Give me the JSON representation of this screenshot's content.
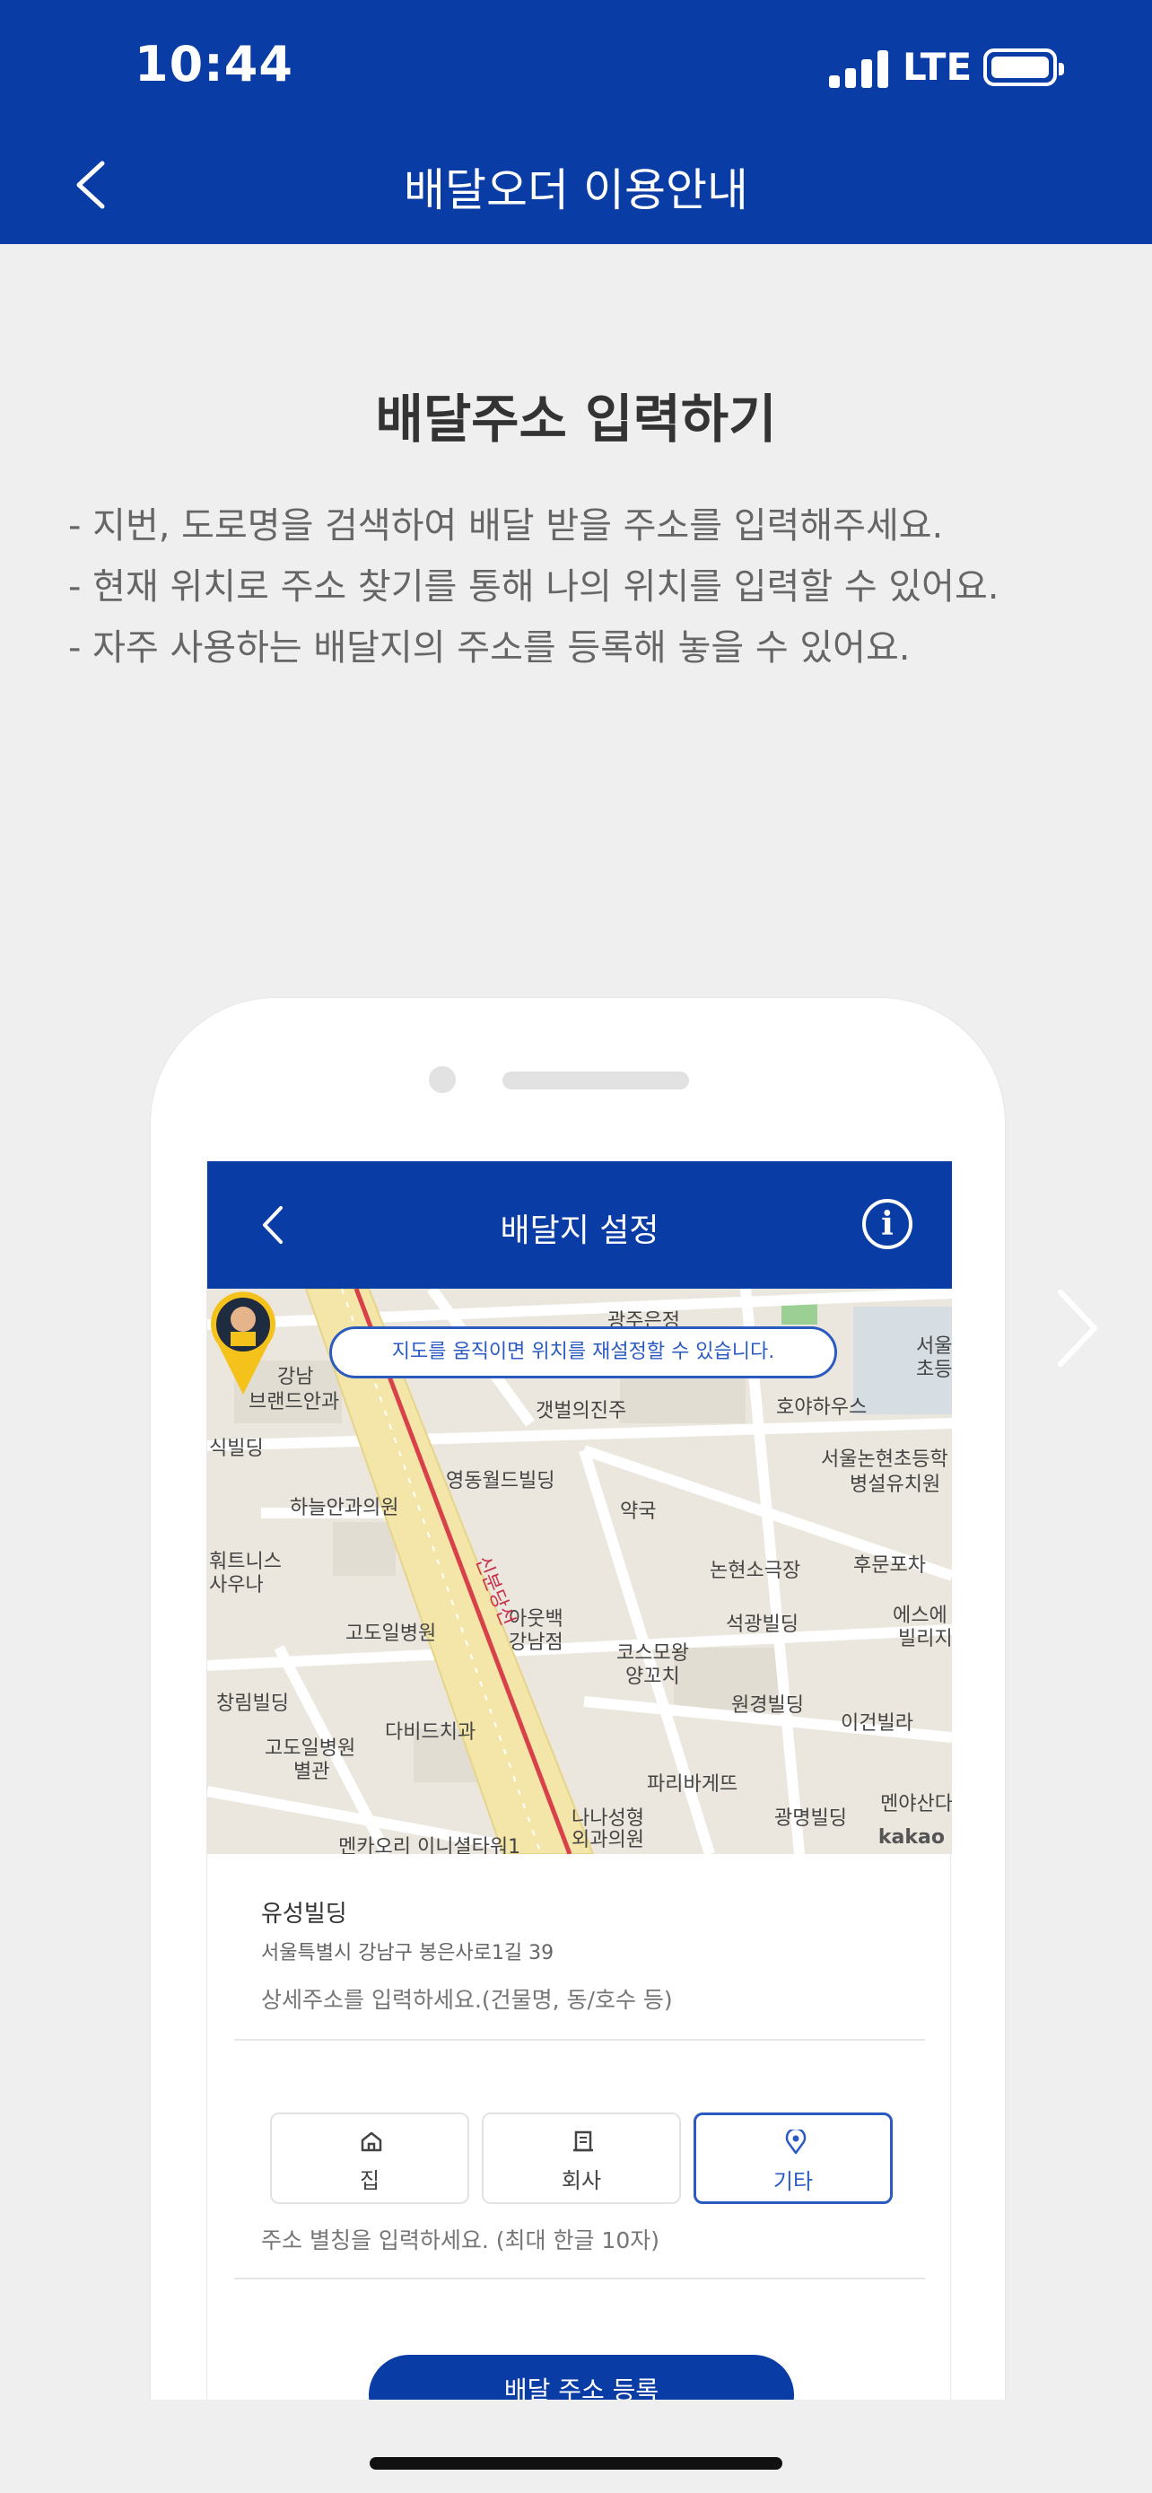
{
  "status_bar": {
    "time": "10:44",
    "network": "LTE"
  },
  "nav": {
    "title": "배달오더 이용안내",
    "back_icon": "chevron-left-icon"
  },
  "content": {
    "heading": "배달주소 입력하기",
    "bullets": [
      "- 지번, 도로명을 검색하여 배달 받을 주소를 입력해주세요.",
      "- 현재 위치로 주소 찾기를 통해 나의 위치를 입력할 수 있어요.",
      "- 자주 사용하는 배달지의 주소를 등록해 놓을 수 있어요."
    ]
  },
  "mockup": {
    "screen_title": "배달지 설정",
    "info_icon": "i",
    "map_banner": "지도를 움직이면 위치를 재설정할 수 있습니다.",
    "map_attribution": "kakao",
    "map_labels": [
      "광주은정",
      "강남",
      "브랜드안과",
      "갯벌의진주",
      "호야하우스",
      "서울",
      "초등",
      "식빌딩",
      "영동월드빌딩",
      "서울논현초등학",
      "병설유치원",
      "하늘안과의원",
      "훠트니스",
      "사우나",
      "약국",
      "논현소극장",
      "후문포차",
      "아웃백",
      "강남점",
      "고도일병원",
      "석광빌딩",
      "에스에",
      "빌리지",
      "코스모왕",
      "양꼬치",
      "창림빌딩",
      "원경빌딩",
      "이건빌라",
      "고도일병원",
      "별관",
      "다비드치과",
      "파리바게뜨",
      "광명빌딩",
      "멘야산다",
      "나나성형",
      "외과의원",
      "멘카오리 이니셜타워1",
      "신분당선"
    ],
    "place_name": "유성빌딩",
    "place_address": "서울특별시 강남구 봉은사로1길 39",
    "detail_placeholder": "상세주소를 입력하세요.(건물명, 동/호수 등)",
    "address_types": [
      {
        "label": "집",
        "icon": "home-icon",
        "selected": false
      },
      {
        "label": "회사",
        "icon": "building-icon",
        "selected": false
      },
      {
        "label": "기타",
        "icon": "location-pin-icon",
        "selected": true
      }
    ],
    "alias_placeholder": "주소 별칭을 입력하세요. (최대 한글 10자)",
    "register_label": "배달 주소 등록"
  },
  "colors": {
    "brand_blue": "#0a3ca6",
    "accent_blue": "#2b5bc1",
    "background": "#efefef"
  }
}
